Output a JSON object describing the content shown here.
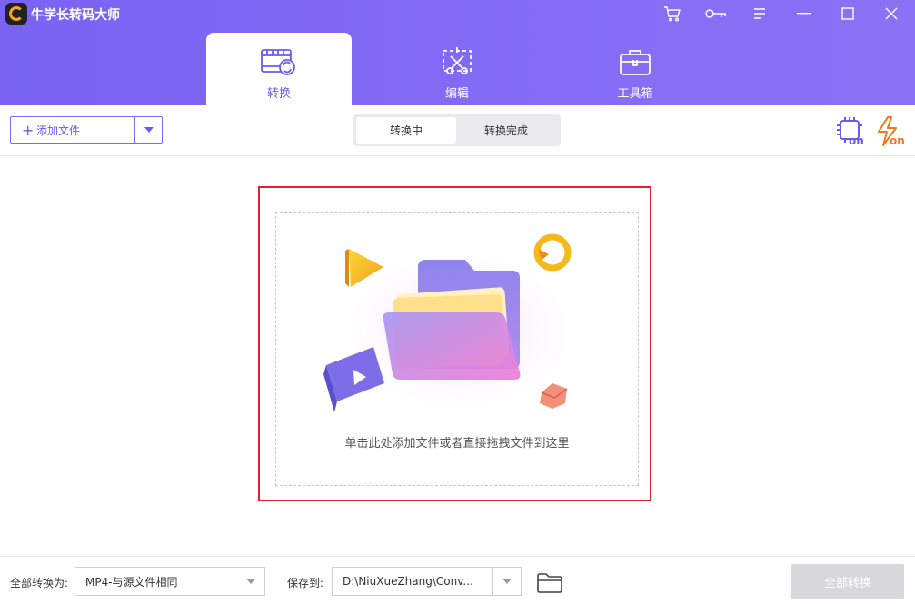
{
  "app": {
    "title": "牛学长转码大师"
  },
  "window_controls": [
    "cart-icon",
    "key-icon",
    "menu-icon",
    "minimize-icon",
    "maximize-icon",
    "close-icon"
  ],
  "tabs": [
    {
      "label": "转换",
      "icon": "film-convert-icon",
      "active": true
    },
    {
      "label": "编辑",
      "icon": "scissors-edit-icon",
      "active": false
    },
    {
      "label": "工具箱",
      "icon": "toolbox-icon",
      "active": false
    }
  ],
  "toolbar": {
    "add_file_label": "添加文件",
    "segments": [
      {
        "label": "转换中",
        "active": true
      },
      {
        "label": "转换完成",
        "active": false
      }
    ],
    "hw_accel_label": "on",
    "fast_label": "on"
  },
  "dropzone": {
    "hint": "单击此处添加文件或者直接拖拽文件到这里"
  },
  "footer": {
    "convert_all_to_label": "全部转换为:",
    "format_value": "MP4-与源文件相同",
    "save_to_label": "保存到:",
    "save_path": "D:\\NiuXueZhang\\Conv...",
    "convert_all_button": "全部转换"
  },
  "colors": {
    "accent": "#7a63f3",
    "outline": "#d9262e"
  }
}
